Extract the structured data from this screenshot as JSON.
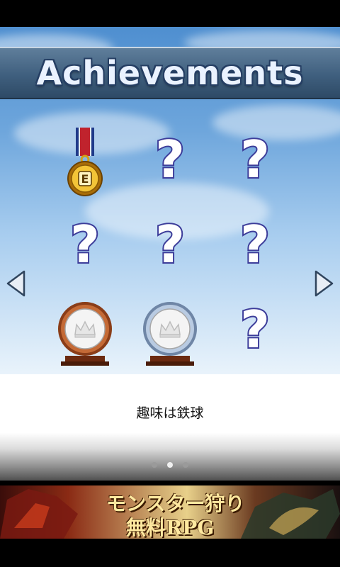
{
  "header": {
    "title": "Achievements"
  },
  "grid": {
    "items": [
      {
        "type": "medal",
        "label": "E"
      },
      {
        "type": "locked",
        "label": "?"
      },
      {
        "type": "locked",
        "label": "?"
      },
      {
        "type": "locked",
        "label": "?"
      },
      {
        "type": "locked",
        "label": "?"
      },
      {
        "type": "locked",
        "label": "?"
      },
      {
        "type": "bronze-plaque"
      },
      {
        "type": "silver-plaque"
      },
      {
        "type": "locked",
        "label": "?"
      }
    ]
  },
  "info": {
    "description": "趣味は鉄球"
  },
  "pager": {
    "count": 3,
    "active": 2
  },
  "ad": {
    "line1": "モンスター狩り",
    "line2": "無料RPG"
  },
  "colors": {
    "banner": "#3f5f7e",
    "question": "#3d3d9a",
    "bronze": "#a0522d",
    "silver": "#9fb7d6"
  }
}
